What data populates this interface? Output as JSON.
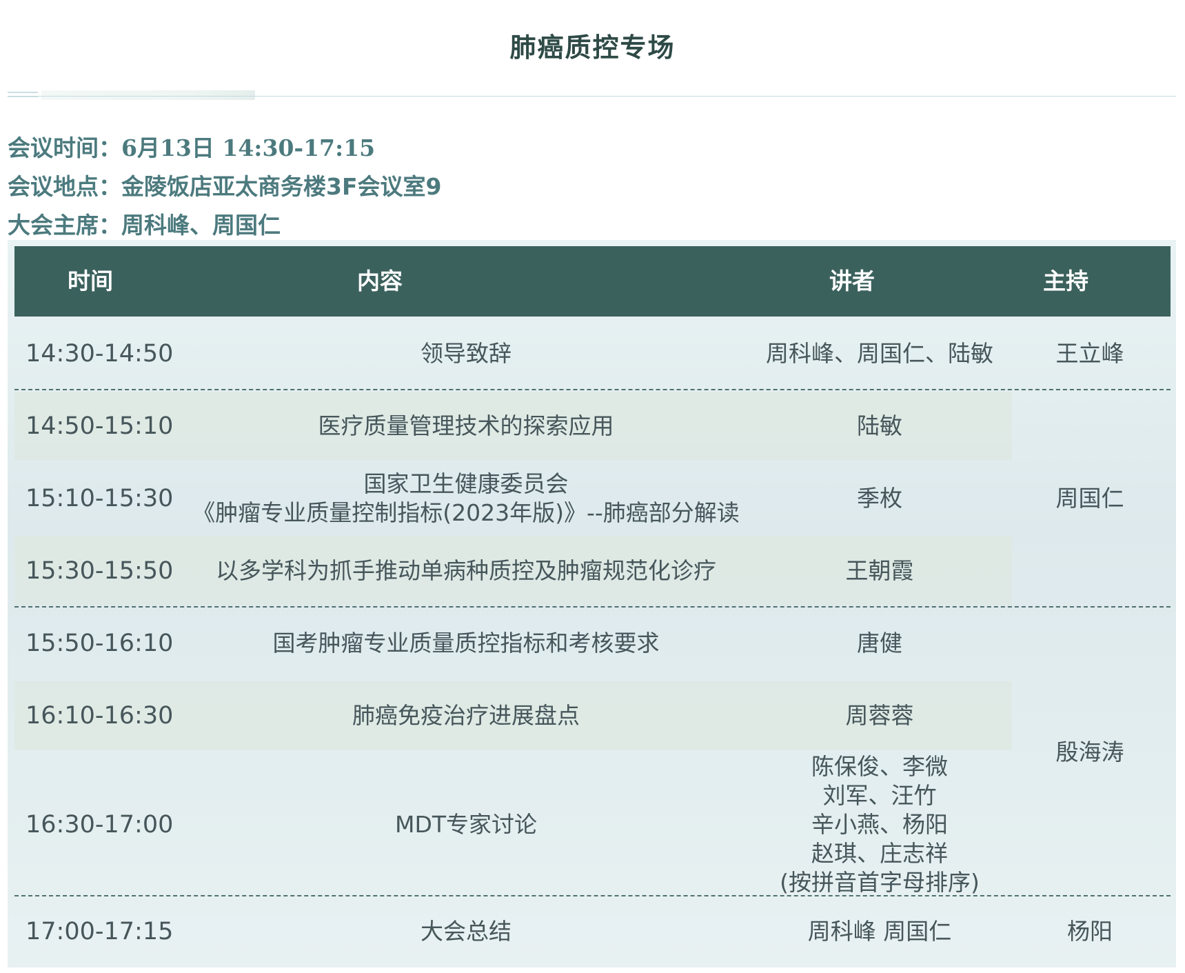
{
  "title": "肺癌质控专场",
  "meeting": {
    "time_label": "会议时间：",
    "time_value": "6月13日 14:30-17:15",
    "place_label": "会议地点：",
    "place_value": "金陵饭店亚太商务楼3F会议室9",
    "chair_label": "大会主席：",
    "chair_value": "周科峰、周国仁"
  },
  "table": {
    "headers": {
      "time": "时间",
      "content": "内容",
      "speaker": "讲者",
      "host": "主持"
    },
    "rows": [
      {
        "time": "14:30-14:50",
        "content": "领导致辞",
        "speaker": "周科峰、周国仁、陆敏"
      },
      {
        "time": "14:50-15:10",
        "content": "医疗质量管理技术的探索应用",
        "speaker": "陆敏"
      },
      {
        "time": "15:10-15:30",
        "content_line1": "国家卫生健康委员会",
        "content_line2": "《肿瘤专业质量控制指标(2023年版)》--肺癌部分解读",
        "speaker": "季枚"
      },
      {
        "time": "15:30-15:50",
        "content": "以多学科为抓手推动单病种质控及肿瘤规范化诊疗",
        "speaker": "王朝霞"
      },
      {
        "time": "15:50-16:10",
        "content": "国考肿瘤专业质量质控指标和考核要求",
        "speaker": "唐健"
      },
      {
        "time": "16:10-16:30",
        "content": "肺癌免疫治疗进展盘点",
        "speaker": "周蓉蓉"
      },
      {
        "time": "16:30-17:00",
        "content": "MDT专家讨论",
        "speaker_lines": [
          "陈保俊、李微",
          "刘军、汪竹",
          "辛小燕、杨阳",
          "赵琪、庄志祥",
          "(按拼音首字母排序)"
        ]
      },
      {
        "time": "17:00-17:15",
        "content": "大会总结",
        "speaker": "周科峰 周国仁"
      }
    ],
    "hosts": [
      "王立峰",
      "周国仁",
      "殷海涛",
      "杨阳"
    ]
  }
}
